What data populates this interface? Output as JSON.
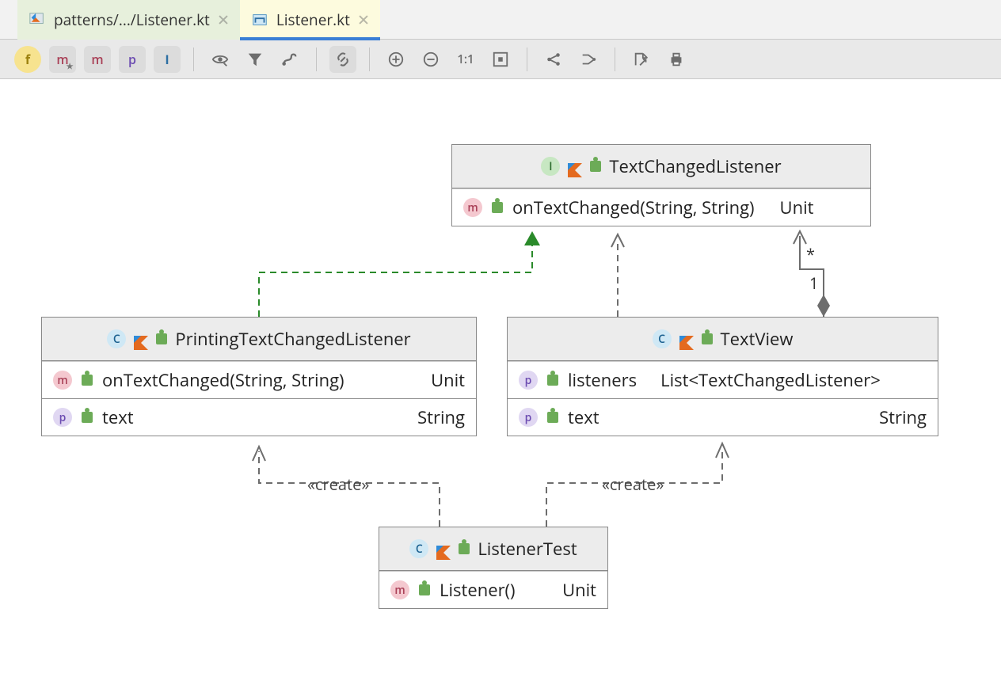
{
  "tabs": [
    {
      "label": "patterns/.../Listener.kt",
      "active": false
    },
    {
      "label": "Listener.kt",
      "active": true
    }
  ],
  "toolbar": {
    "btn_f": "f",
    "btn_m_star": "m",
    "btn_m": "m",
    "btn_p": "p",
    "btn_i": "I"
  },
  "interface": {
    "title": "TextChangedListener",
    "method": {
      "sig": "onTextChanged(String, String)",
      "type": "Unit"
    }
  },
  "printingListener": {
    "title": "PrintingTextChangedListener",
    "method": {
      "sig": "onTextChanged(String, String)",
      "type": "Unit"
    },
    "prop": {
      "name": "text",
      "type": "String"
    }
  },
  "textView": {
    "title": "TextView",
    "prop_listeners": {
      "name": "listeners",
      "type": "List<TextChangedListener>"
    },
    "prop_text": {
      "name": "text",
      "type": "String"
    }
  },
  "listenerTest": {
    "title": "ListenerTest",
    "method": {
      "sig": "Listener()",
      "type": "Unit"
    }
  },
  "edges": {
    "create1": "«create»",
    "create2": "«create»",
    "multN": "*",
    "mult1": "1"
  }
}
